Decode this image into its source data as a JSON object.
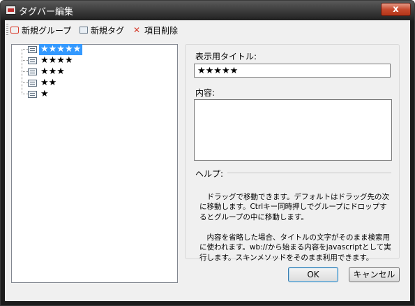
{
  "window": {
    "title": "タグバー編集",
    "close_label": "x"
  },
  "toolbar": {
    "new_group": "新規グループ",
    "new_tag": "新規タグ",
    "delete_item": "項目削除"
  },
  "tree": {
    "items": [
      {
        "label": "★★★★★",
        "selected": true
      },
      {
        "label": "★★★★",
        "selected": false
      },
      {
        "label": "★★★",
        "selected": false
      },
      {
        "label": "★★",
        "selected": false
      },
      {
        "label": "★",
        "selected": false
      }
    ]
  },
  "form": {
    "title_label": "表示用タイトル:",
    "title_value": "★★★★★",
    "content_label": "内容:",
    "content_value": ""
  },
  "help": {
    "heading": "ヘルプ:",
    "paragraph1": "ドラッグで移動できます。デフォルトはドラッグ先の次に移動します。Ctrlキー同時押しでグループにドロップするとグループの中に移動します。",
    "paragraph2": "内容を省略した場合、タイトルの文字がそのまま検索用に使われます。wb://から始まる内容をjavascriptとして実行します。スキンメソッドをそのまま利用できます。"
  },
  "buttons": {
    "ok": "OK",
    "cancel": "キャンセル"
  }
}
